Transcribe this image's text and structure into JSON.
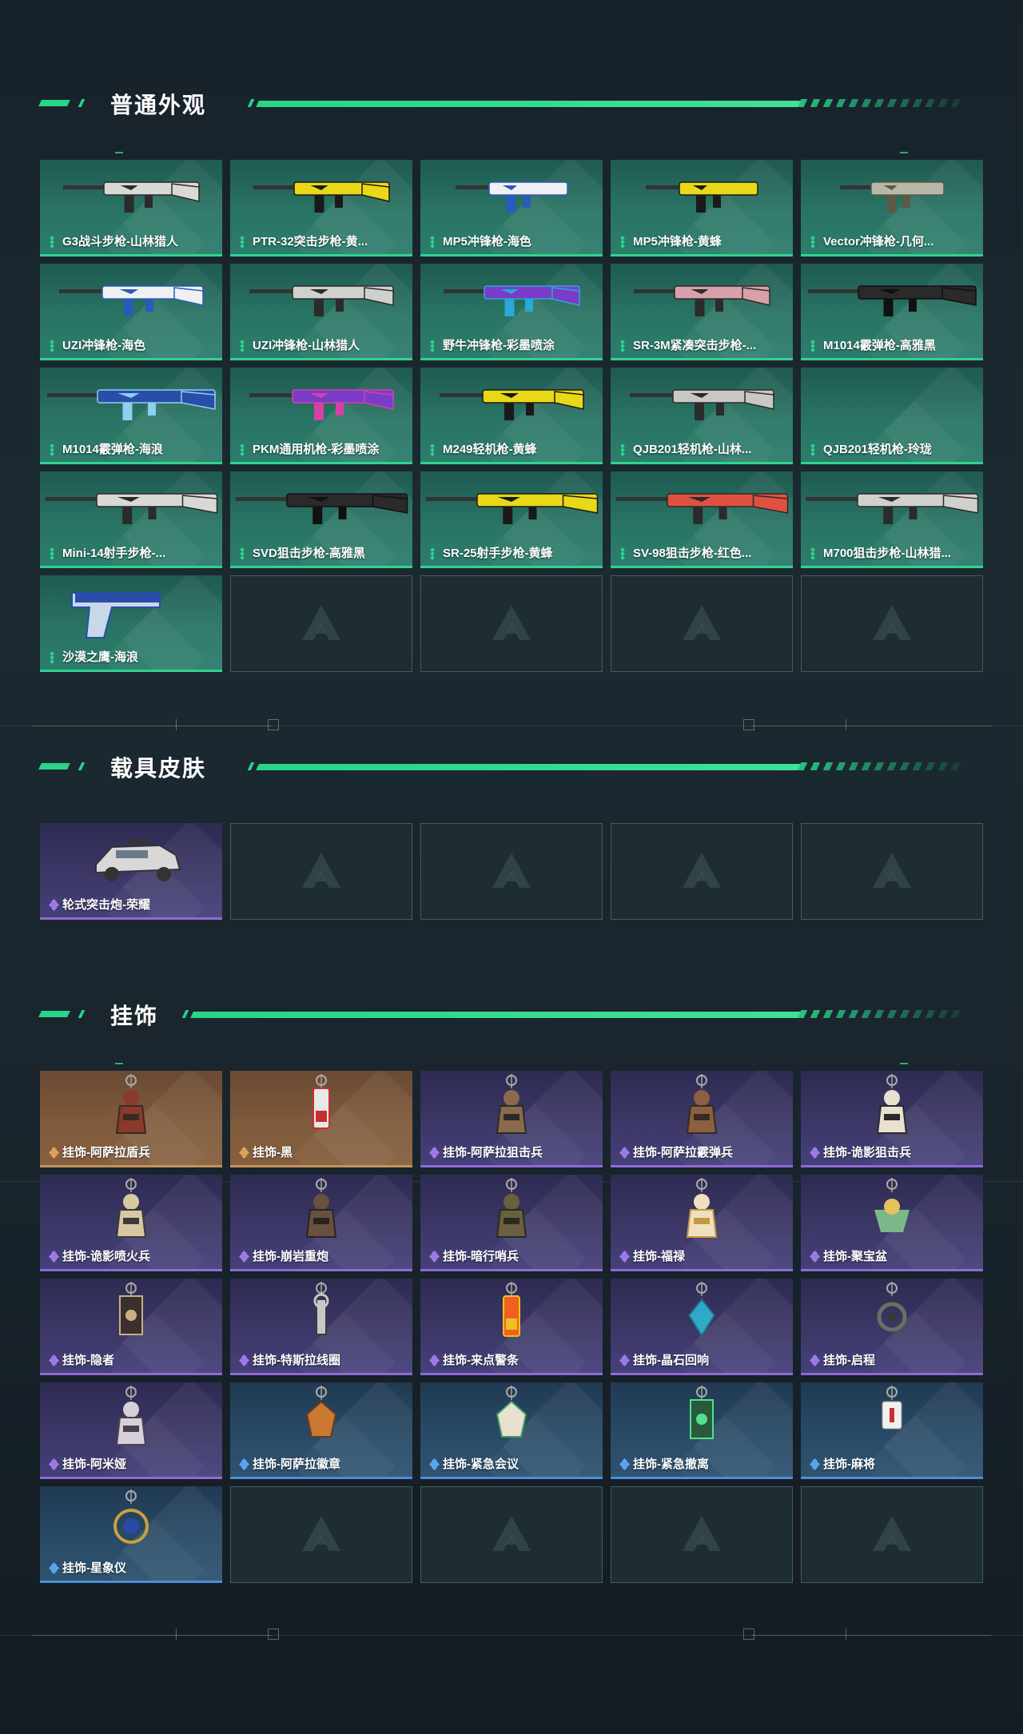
{
  "sections": [
    {
      "title": "普通外观",
      "cards": [
        {
          "label": "G3战斗步枪-山林猎人",
          "rarity": "green",
          "art": "rifle",
          "c1": "#d8d8d4",
          "c2": "#2b2b2b"
        },
        {
          "label": "PTR-32突击步枪-黄...",
          "rarity": "green",
          "art": "ak",
          "c1": "#e8d818",
          "c2": "#1a1a1a"
        },
        {
          "label": "MP5冲锋枪-海色",
          "rarity": "green",
          "art": "smg",
          "c1": "#f0f0f2",
          "c2": "#2a5bb8"
        },
        {
          "label": "MP5冲锋枪-黄蜂",
          "rarity": "green",
          "art": "smg",
          "c1": "#e8d818",
          "c2": "#1a1a1a"
        },
        {
          "label": "Vector冲锋枪-几何...",
          "rarity": "green",
          "art": "vector",
          "c1": "#b8b8a8",
          "c2": "#5a5a48"
        },
        {
          "label": "UZI冲锋枪-海色",
          "rarity": "green",
          "art": "uzi",
          "c1": "#f0f0f2",
          "c2": "#2a5bb8"
        },
        {
          "label": "UZI冲锋枪-山林猎人",
          "rarity": "green",
          "art": "uzi",
          "c1": "#d0d0cc",
          "c2": "#2b2b2b"
        },
        {
          "label": "野牛冲锋枪-彩墨喷涂",
          "rarity": "green",
          "art": "rifle",
          "c1": "#7a3cc8",
          "c2": "#2aa8d8"
        },
        {
          "label": "SR-3M紧凑突击步枪-...",
          "rarity": "green",
          "art": "ak",
          "c1": "#d8a0a8",
          "c2": "#2b2b2b"
        },
        {
          "label": "M1014霰弹枪-高雅黑",
          "rarity": "green",
          "art": "shotgun",
          "c1": "#2a2a2a",
          "c2": "#111111"
        },
        {
          "label": "M1014霰弹枪-海浪",
          "rarity": "green",
          "art": "shotgun",
          "c1": "#2a4ea8",
          "c2": "#8ad0f0"
        },
        {
          "label": "PKM通用机枪-彩墨喷涂",
          "rarity": "green",
          "art": "mg",
          "c1": "#7a3cc8",
          "c2": "#d840a8"
        },
        {
          "label": "M249轻机枪-黄蜂",
          "rarity": "green",
          "art": "mg",
          "c1": "#e8d818",
          "c2": "#1a1a1a"
        },
        {
          "label": "QJB201轻机枪-山林...",
          "rarity": "green",
          "art": "mg",
          "c1": "#c8c8c4",
          "c2": "#2b2b2b"
        },
        {
          "label": "QJB201轻机枪-玲珑",
          "rarity": "green",
          "art": "none",
          "c1": "#cccccc",
          "c2": "#333333"
        },
        {
          "label": "Mini-14射手步枪-...",
          "rarity": "green",
          "art": "sniper",
          "c1": "#d8d8d4",
          "c2": "#2b2b2b"
        },
        {
          "label": "SVD狙击步枪-高雅黑",
          "rarity": "green",
          "art": "sniper",
          "c1": "#2a2a2a",
          "c2": "#111111"
        },
        {
          "label": "SR-25射手步枪-黄蜂",
          "rarity": "green",
          "art": "sniper",
          "c1": "#e8d818",
          "c2": "#1a1a1a"
        },
        {
          "label": "SV-98狙击步枪-红色...",
          "rarity": "green",
          "art": "sniper",
          "c1": "#e05040",
          "c2": "#2b2b2b"
        },
        {
          "label": "M700狙击步枪-山林猎...",
          "rarity": "green",
          "art": "sniper",
          "c1": "#d0d0cc",
          "c2": "#2b2b2b"
        },
        {
          "label": "沙漠之鹰-海浪",
          "rarity": "green",
          "art": "pistol",
          "c1": "#2a4ea8",
          "c2": "#c8d8e8"
        }
      ],
      "empty": 4
    },
    {
      "title": "载具皮肤",
      "cards": [
        {
          "label": "轮式突击炮-荣耀",
          "rarity": "purple",
          "art": "vehicle",
          "c1": "#d8d8d8",
          "c2": "#333333"
        }
      ],
      "empty": 4
    },
    {
      "title": "挂饰",
      "cards": [
        {
          "label": "挂饰-阿萨拉盾兵",
          "rarity": "orange",
          "art": "figure",
          "c1": "#8a3a2a",
          "c2": "#3a2a22"
        },
        {
          "label": "挂饰-黑",
          "rarity": "orange",
          "art": "tag",
          "c1": "#e8e8e8",
          "c2": "#c83030"
        },
        {
          "label": "挂饰-阿萨拉狙击兵",
          "rarity": "purple",
          "art": "figure",
          "c1": "#8a6a4a",
          "c2": "#2a2a2a"
        },
        {
          "label": "挂饰-阿萨拉霰弹兵",
          "rarity": "purple",
          "art": "figure",
          "c1": "#8a6040",
          "c2": "#3a2a22"
        },
        {
          "label": "挂饰-诡影狙击兵",
          "rarity": "purple",
          "art": "figure",
          "c1": "#e8e0d0",
          "c2": "#2a2a2a"
        },
        {
          "label": "挂饰-诡影喷火兵",
          "rarity": "purple",
          "art": "figure",
          "c1": "#d8c8a0",
          "c2": "#3a3a3a"
        },
        {
          "label": "挂饰-崩岩重炮",
          "rarity": "purple",
          "art": "figure",
          "c1": "#6a5040",
          "c2": "#2a2420"
        },
        {
          "label": "挂饰-暗行哨兵",
          "rarity": "purple",
          "art": "figure",
          "c1": "#6a6040",
          "c2": "#2a2a20"
        },
        {
          "label": "挂饰-福禄",
          "rarity": "purple",
          "art": "figure",
          "c1": "#f0e0c0",
          "c2": "#c89840"
        },
        {
          "label": "挂饰-聚宝盆",
          "rarity": "purple",
          "art": "bowl",
          "c1": "#7ab88a",
          "c2": "#e8c060"
        },
        {
          "label": "挂饰-隐者",
          "rarity": "purple",
          "art": "card",
          "c1": "#3a3030",
          "c2": "#c8b080"
        },
        {
          "label": "挂饰-特斯拉线圈",
          "rarity": "purple",
          "art": "coil",
          "c1": "#c8c8c8",
          "c2": "#3a3a3a"
        },
        {
          "label": "挂饰-来点警条",
          "rarity": "purple",
          "art": "tag",
          "c1": "#f06020",
          "c2": "#f0c020"
        },
        {
          "label": "挂饰-晶石回响",
          "rarity": "purple",
          "art": "gem",
          "c1": "#30a8c8",
          "c2": "#206880"
        },
        {
          "label": "挂饰-启程",
          "rarity": "purple",
          "art": "ring",
          "c1": "#6a7060",
          "c2": "#3a3a30"
        },
        {
          "label": "挂饰-阿米娅",
          "rarity": "purple",
          "art": "figure",
          "c1": "#d8d0d8",
          "c2": "#4a4050"
        },
        {
          "label": "挂饰-阿萨拉徽章",
          "rarity": "blue",
          "art": "badge",
          "c1": "#c87a30",
          "c2": "#6a3a20"
        },
        {
          "label": "挂饰-紧急会议",
          "rarity": "blue",
          "art": "badge",
          "c1": "#e8e0d0",
          "c2": "#40a060"
        },
        {
          "label": "挂饰-紧急撤离",
          "rarity": "blue",
          "art": "card",
          "c1": "#2a5a3a",
          "c2": "#50e090"
        },
        {
          "label": "挂饰-麻将",
          "rarity": "blue",
          "art": "tile",
          "c1": "#f0f0ec",
          "c2": "#c83030"
        },
        {
          "label": "挂饰-星象仪",
          "rarity": "blue",
          "art": "orb",
          "c1": "#c8a040",
          "c2": "#2a4aa8"
        }
      ],
      "empty": 4
    }
  ],
  "colors": {
    "accent": "#29d38a",
    "green_card": "#2a7464",
    "purple_card": "#3c3766",
    "orange_card": "#7f5a3c",
    "blue_card": "#294a66",
    "empty_card": "#1e2d31"
  }
}
